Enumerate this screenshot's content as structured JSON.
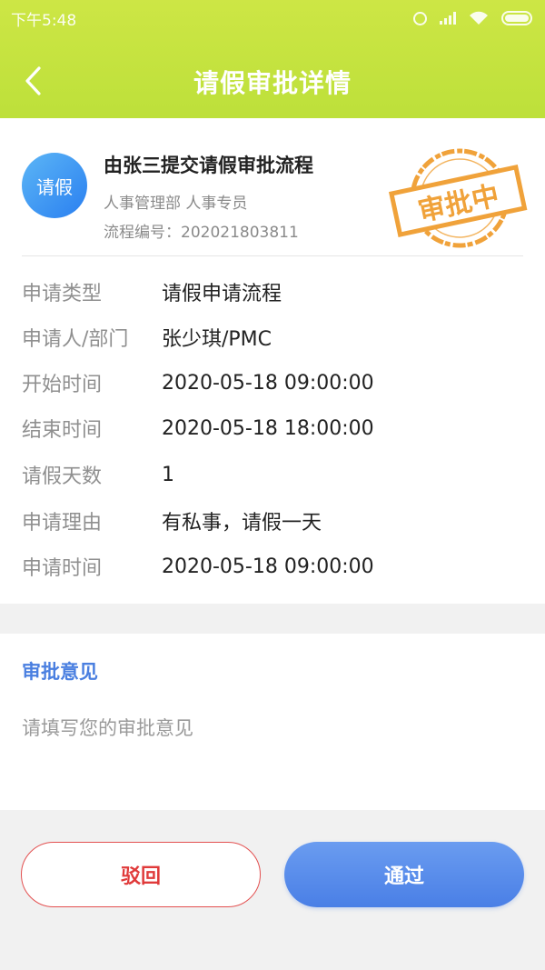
{
  "status_bar": {
    "time": "下午5:48"
  },
  "navbar": {
    "title": "请假审批详情",
    "back_icon": "chevron-left-icon"
  },
  "request": {
    "avatar_label": "请假",
    "title": "由张三提交请假审批流程",
    "department": "人事管理部 人事专员",
    "process_number": "流程编号：202021803811",
    "stamp_text": "审批中",
    "stamp_color": "#f0a23a"
  },
  "fields": [
    {
      "label": "申请类型",
      "value": "请假申请流程"
    },
    {
      "label": "申请人/部门",
      "value": "张少琪/PMC"
    },
    {
      "label": "开始时间",
      "value": "2020-05-18 09:00:00"
    },
    {
      "label": "结束时间",
      "value": "2020-05-18 18:00:00"
    },
    {
      "label": "请假天数",
      "value": "1"
    },
    {
      "label": "申请理由",
      "value": "有私事，请假一天"
    },
    {
      "label": "申请时间",
      "value": "2020-05-18 09:00:00"
    }
  ],
  "opinion": {
    "title": "审批意见",
    "placeholder": "请填写您的审批意见",
    "value": ""
  },
  "actions": {
    "reject_label": "驳回",
    "approve_label": "通过"
  },
  "colors": {
    "header": "#c6e33f",
    "accent_blue": "#4a7fe0",
    "reject_red": "#e03a3a",
    "stamp_orange": "#f0a23a"
  }
}
